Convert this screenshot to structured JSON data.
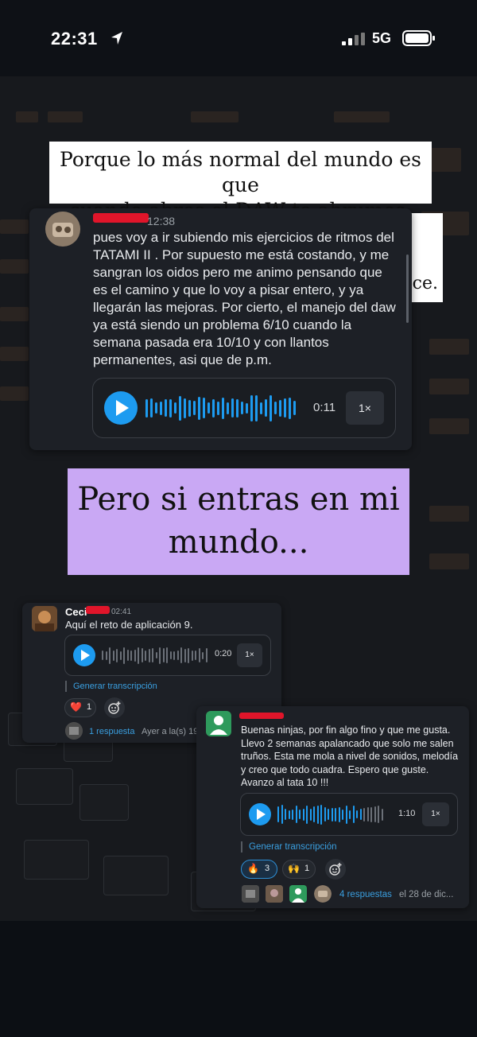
{
  "status_bar": {
    "time": "22:31",
    "network": "5G"
  },
  "caption_top": {
    "line1": "Porque lo más normal del mundo es que",
    "line2": "cuando abres el DAW te abrumes.",
    "hidden_fragment": "ce."
  },
  "caption_middle": {
    "line1": "Pero si entras en mi",
    "line2": "mundo..."
  },
  "message1": {
    "time": "12:38",
    "text": "pues voy a ir subiendo mis ejercicios de ritmos del TATAMI II . Por supuesto me está costando, y me sangran los oidos pero me animo pensando que es el camino y que lo voy a pisar entero, y ya llegarán las mejoras. Por cierto, el manejo del daw ya está siendo un problema 6/10 cuando la semana pasada era 10/10 y con llantos permanentes, asi que de p.m.",
    "audio_duration": "0:11",
    "speed": "1×"
  },
  "message2": {
    "name_visible": "Ceci",
    "time": "02:41",
    "text": "Aquí el reto de aplicación 9.",
    "audio_duration": "0:20",
    "speed": "1×",
    "transcript_link": "Generar transcripción",
    "reaction_emoji": "❤️",
    "reaction_count": "1",
    "replies_link": "1 respuesta",
    "replies_meta": "Ayer a la(s) 19"
  },
  "message3": {
    "text": "Buenas ninjas, por fin algo fino y que me gusta. Llevo 2 semanas apalancado que solo me salen truños. Esta me mola a nivel de sonidos, melodía y creo que todo cuadra. Espero que guste. Avanzo al tata 10 !!!",
    "audio_duration": "1:10",
    "speed": "1×",
    "transcript_link": "Generar transcripción",
    "reactions": [
      {
        "emoji": "🔥",
        "count": "3",
        "active": true
      },
      {
        "emoji": "🙌",
        "count": "1",
        "active": false
      }
    ],
    "replies_link": "4 respuestas",
    "replies_meta": "el 28 de dic..."
  },
  "colors": {
    "accent": "#1d9bf0",
    "purple": "#c9a8f4",
    "card": "#1d2026",
    "redaction": "#e0152a"
  },
  "icons": [
    "location-arrow-icon",
    "signal-icon",
    "battery-icon",
    "play-icon",
    "add-reaction-icon",
    "avatar-icon"
  ]
}
